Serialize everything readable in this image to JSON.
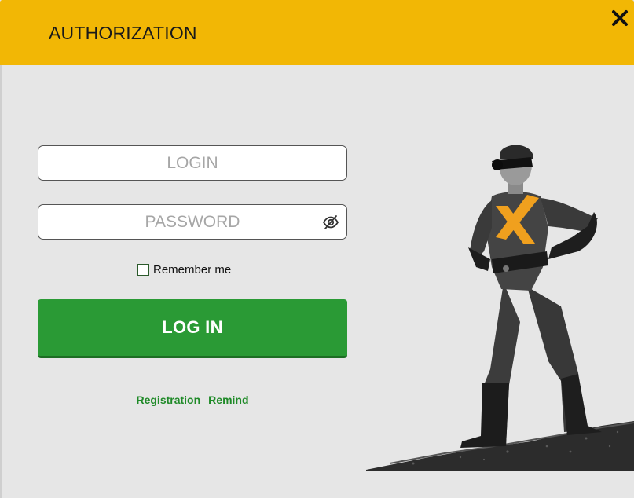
{
  "dialog": {
    "title": "AUTHORIZATION",
    "close_icon": "close-icon"
  },
  "form": {
    "login": {
      "value": "",
      "placeholder": "LOGIN"
    },
    "password": {
      "value": "",
      "placeholder": "PASSWORD",
      "toggle_icon": "eye-slash-icon"
    },
    "remember": {
      "label": "Remember me",
      "checked": false
    },
    "submit_label": "LOG IN"
  },
  "links": {
    "registration": "Registration",
    "remind": "Remind"
  },
  "colors": {
    "header": "#f2b705",
    "background": "#e6e6e6",
    "primary_button": "#2a9a35",
    "link": "#1f8a28",
    "hero_emblem": "#f0a01e"
  },
  "illustration": {
    "name": "superhero-mascot",
    "emblem_icon": "x-logo-icon"
  }
}
